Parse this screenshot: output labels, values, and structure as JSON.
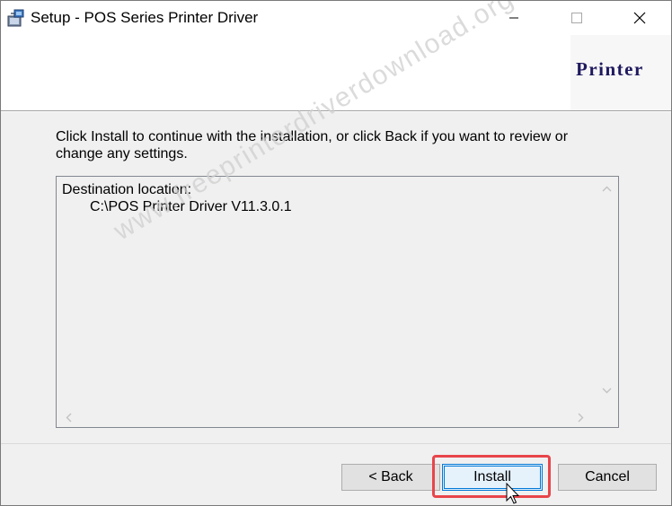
{
  "window": {
    "title": "Setup - POS Series Printer Driver",
    "icon": "setup-installer-icon",
    "controls": [
      "minimize-icon",
      "maximize-icon",
      "close-icon"
    ]
  },
  "header": {
    "logo_text": "Printer"
  },
  "body": {
    "instruction": "Click Install to continue with the installation, or click Back if you want to review or change any settings.",
    "summary_line1": "Destination location:",
    "summary_line2": "C:\\POS Printer Driver V11.3.0.1"
  },
  "watermark": "www.freeprinterdriverdownload.org",
  "buttons": {
    "back": "< Back",
    "install": "Install",
    "cancel": "Cancel"
  },
  "colors": {
    "highlight": "#e8454a",
    "focus": "#0078d7",
    "logo": "#1f1a5e"
  }
}
